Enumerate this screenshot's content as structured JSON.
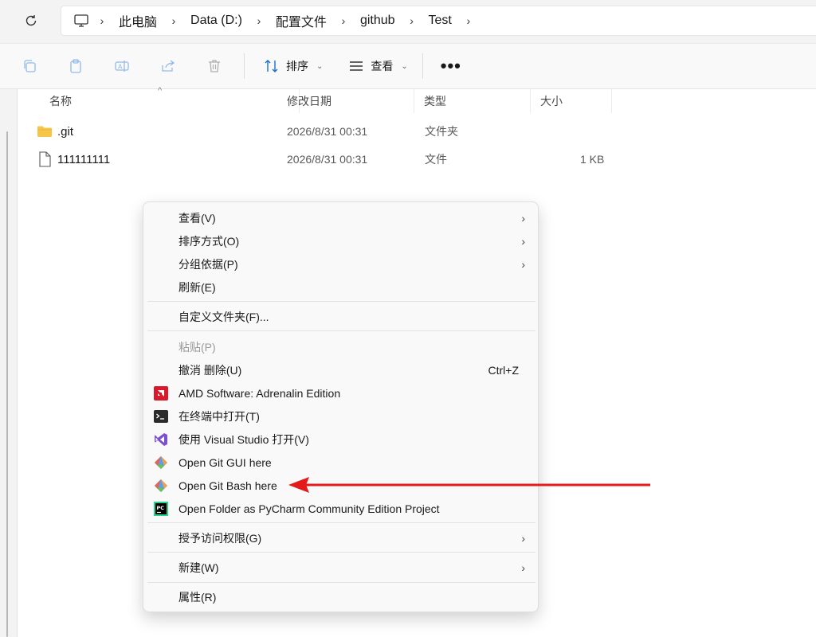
{
  "address_bar": {
    "breadcrumbs": [
      "此电脑",
      "Data (D:)",
      "配置文件",
      "github",
      "Test"
    ]
  },
  "toolbar": {
    "sort_label": "排序",
    "view_label": "查看",
    "more_label": "•••"
  },
  "columns": {
    "name": "名称",
    "modified": "修改日期",
    "type": "类型",
    "size": "大小"
  },
  "files": [
    {
      "name": ".git",
      "modified": "2026/8/31 00:31",
      "type": "文件夹",
      "size": "",
      "icon": "folder-icon"
    },
    {
      "name": "111111111",
      "modified": "2026/8/31 00:31",
      "type": "文件",
      "size": "1 KB",
      "icon": "file-icon"
    }
  ],
  "context_menu": {
    "items": [
      {
        "label": "查看(V)",
        "submenu": true
      },
      {
        "label": "排序方式(O)",
        "submenu": true
      },
      {
        "label": "分组依据(P)",
        "submenu": true
      },
      {
        "label": "刷新(E)"
      },
      {
        "label": "自定义文件夹(F)..."
      },
      {
        "label": "粘贴(P)",
        "disabled": true
      },
      {
        "label": "撤消 删除(U)",
        "shortcut": "Ctrl+Z"
      },
      {
        "label": "AMD Software: Adrenalin Edition",
        "icon": "amd-icon"
      },
      {
        "label": "在终端中打开(T)",
        "icon": "terminal-icon"
      },
      {
        "label": "使用 Visual Studio 打开(V)",
        "icon": "visual-studio-icon"
      },
      {
        "label": "Open Git GUI here",
        "icon": "git-icon"
      },
      {
        "label": "Open Git Bash here",
        "icon": "git-icon"
      },
      {
        "label": "Open Folder as PyCharm Community Edition Project",
        "icon": "pycharm-icon"
      },
      {
        "label": "授予访问权限(G)",
        "submenu": true
      },
      {
        "label": "新建(W)",
        "submenu": true
      },
      {
        "label": "属性(R)"
      }
    ]
  },
  "colors": {
    "annotation_arrow": "#e31b1b",
    "folder": "#f5c648",
    "amd": "#d7192b",
    "visual_studio": "#7b4fcf"
  }
}
